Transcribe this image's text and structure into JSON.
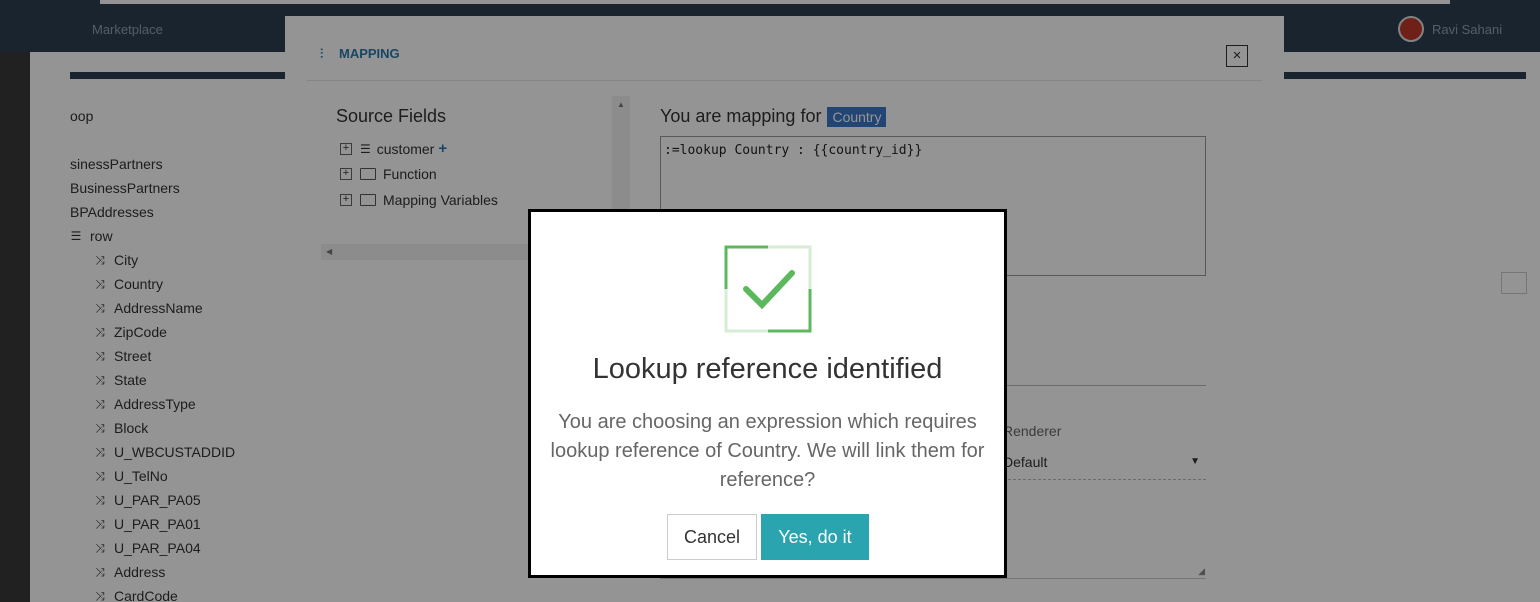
{
  "topbar": {
    "app_name": "Marketplace",
    "user_name": "Ravi Sahani"
  },
  "tree": {
    "items": [
      {
        "label": "oop",
        "icon": ""
      },
      {
        "label": "sinessPartners",
        "icon": ""
      },
      {
        "label": "BusinessPartners",
        "icon": ""
      },
      {
        "label": "BPAddresses",
        "icon": ""
      },
      {
        "label": "row",
        "icon": "table-icon"
      },
      {
        "label": "City",
        "icon": "shuffle-icon"
      },
      {
        "label": "Country",
        "icon": "shuffle-icon"
      },
      {
        "label": "AddressName",
        "icon": "shuffle-icon"
      },
      {
        "label": "ZipCode",
        "icon": "shuffle-icon"
      },
      {
        "label": "Street",
        "icon": "shuffle-icon"
      },
      {
        "label": "State",
        "icon": "shuffle-icon"
      },
      {
        "label": "AddressType",
        "icon": "shuffle-icon"
      },
      {
        "label": "Block",
        "icon": "shuffle-icon"
      },
      {
        "label": "U_WBCUSTADDID",
        "icon": "shuffle-icon"
      },
      {
        "label": "U_TelNo",
        "icon": "shuffle-icon"
      },
      {
        "label": "U_PAR_PA05",
        "icon": "shuffle-icon"
      },
      {
        "label": "U_PAR_PA01",
        "icon": "shuffle-icon"
      },
      {
        "label": "U_PAR_PA04",
        "icon": "shuffle-icon"
      },
      {
        "label": "Address",
        "icon": "shuffle-icon"
      },
      {
        "label": "CardCode",
        "icon": "shuffle-icon"
      }
    ]
  },
  "mapping_modal": {
    "title": "MAPPING",
    "close_label": "×",
    "source_fields_title": "Source Fields",
    "source_nodes": [
      {
        "label": "customer",
        "icon": "database-icon",
        "has_add": true
      },
      {
        "label": "Function",
        "icon": "folder-icon",
        "has_add": false
      },
      {
        "label": "Mapping Variables",
        "icon": "folder-icon",
        "has_add": false
      }
    ],
    "mapping_for_label": "You are mapping for",
    "mapping_for_badge": "Country",
    "expression": ":=lookup Country : {{country_id}}",
    "renderer_label": "Renderer",
    "renderer_value": "Default"
  },
  "alert": {
    "icon": "check-icon",
    "title": "Lookup reference identified",
    "text": "You are choosing an expression which requires lookup reference of Country. We will link them for reference?",
    "cancel_label": "Cancel",
    "confirm_label": "Yes, do it",
    "colors": {
      "confirm": "#2aa5b0",
      "check": "#5cb85c"
    }
  }
}
